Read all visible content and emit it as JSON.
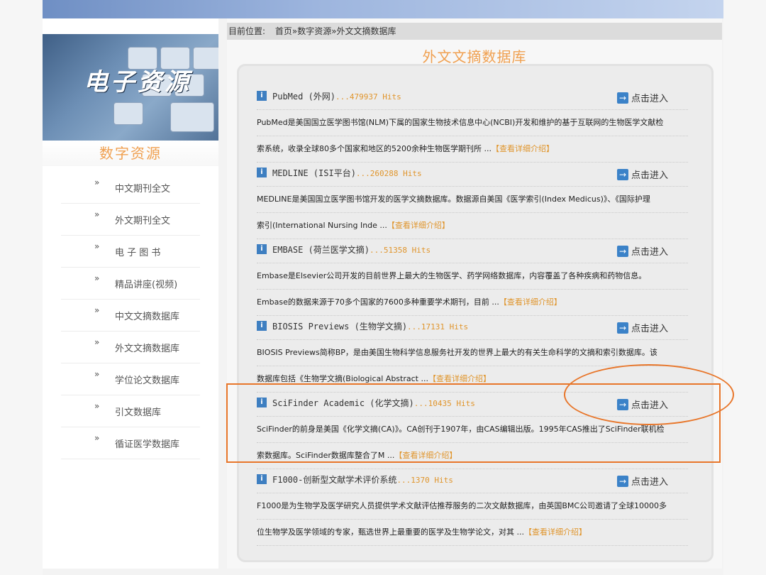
{
  "breadcrumb": {
    "prefix": "目前位置:",
    "path": "首页»数字资源»外文文摘数据库"
  },
  "sidebar": {
    "banner_title": "电子资源",
    "section_title": "数字资源",
    "bullet": "»",
    "items": [
      {
        "label": "中文期刊全文"
      },
      {
        "label": "外文期刊全文"
      },
      {
        "label": "电 子 图 书"
      },
      {
        "label": "精品讲座(视频)"
      },
      {
        "label": "中文文摘数据库"
      },
      {
        "label": "外文文摘数据库"
      },
      {
        "label": "学位论文数据库"
      },
      {
        "label": "引文数据库"
      },
      {
        "label": "循证医学数据库"
      }
    ]
  },
  "main": {
    "title": "外文文摘数据库",
    "enter_label": "点击进入",
    "detail_label": "【查看详细介绍】",
    "entries": [
      {
        "name": "PubMed (外网)",
        "hits": "...479937 Hits",
        "line1": "PubMed是美国国立医学图书馆(NLM)下属的国家生物技术信息中心(NCBI)开发和维护的基于互联网的生物医学文献检",
        "line2": "索系统，收录全球80多个国家和地区的5200余种生物医学期刊所 ..."
      },
      {
        "name": "MEDLINE (ISI平台)",
        "hits": "...260288 Hits",
        "line1": "MEDLINE是美国国立医学图书馆开发的医学文摘数据库。数据源自美国《医学索引(Index Medicus)》、《国际护理",
        "line2": "索引(International Nursing Inde ..."
      },
      {
        "name": "EMBASE (荷兰医学文摘)",
        "hits": "...51358 Hits",
        "line1": "Embase是Elsevier公司开发的目前世界上最大的生物医学、药学网络数据库，内容覆盖了各种疾病和药物信息。",
        "line2": "Embase的数据来源于70多个国家的7600多种重要学术期刊，目前 ..."
      },
      {
        "name": "BIOSIS Previews (生物学文摘)",
        "hits": "...17131 Hits",
        "line1": "BIOSIS Previews简称BP，是由美国生物科学信息服务社开发的世界上最大的有关生命科学的文摘和索引数据库。该",
        "line2": "数据库包括《生物学文摘(Biological Abstract ..."
      },
      {
        "name": "SciFinder Academic (化学文摘)",
        "hits": "...10435 Hits",
        "line1": "SciFinder的前身是美国《化学文摘(CA)》。CA创刊于1907年，由CAS编辑出版。1995年CAS推出了SciFinder联机检",
        "line2": "索数据库。SciFinder数据库整合了M ..."
      },
      {
        "name": "F1000-创新型文献学术评价系统",
        "hits": "...1370 Hits",
        "line1": "F1000是为生物学及医学研究人员提供学术文献评估推荐服务的二次文献数据库，由英国BMC公司邀请了全球10000多",
        "line2": "位生物学及医学领域的专家，甄选世界上最重要的医学及生物学论文，对其 ..."
      }
    ]
  },
  "colors": {
    "accent_orange": "#f0a050",
    "annotation_orange": "#e8762a",
    "link_blue": "#3b82c8"
  }
}
